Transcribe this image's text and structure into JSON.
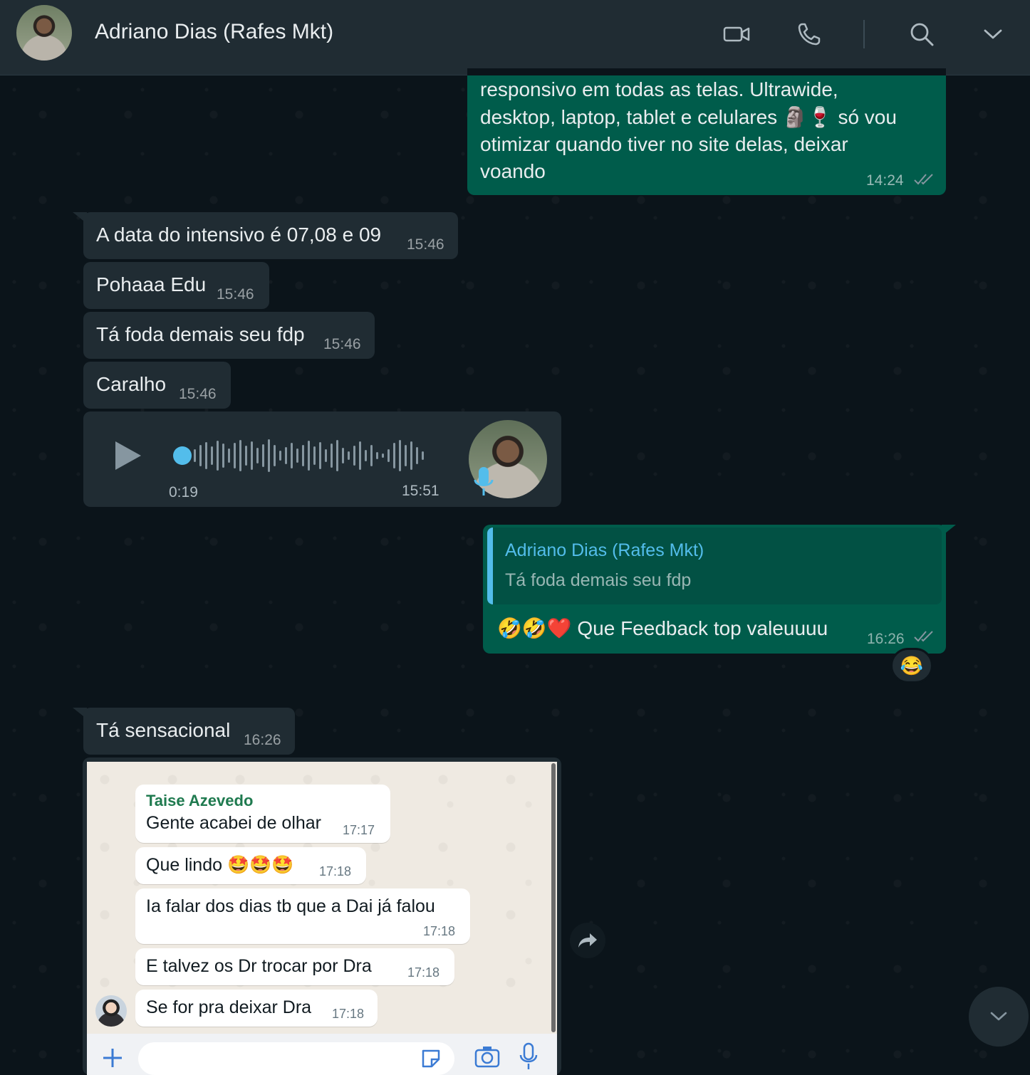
{
  "header": {
    "contact_name": "Adriano Dias (Rafes Mkt)",
    "icons": [
      "video-call-icon",
      "voice-call-icon",
      "search-icon",
      "chevron-down-icon"
    ]
  },
  "messages": {
    "m1": {
      "lines": [
        "responsivo em todas as telas. Ultrawide,",
        "desktop, laptop, tablet e celulares 🗿🍷 só vou",
        "otimizar quando tiver no site delas, deixar",
        "voando"
      ],
      "time": "14:24"
    },
    "m2": {
      "text": "A data do intensivo é 07,08 e 09",
      "time": "15:46"
    },
    "m3": {
      "text": "Pohaaa Edu",
      "time": "15:46"
    },
    "m4": {
      "text": "Tá foda demais seu fdp",
      "time": "15:46"
    },
    "m5": {
      "text": "Caralho",
      "time": "15:46"
    },
    "voice": {
      "duration": "0:19",
      "time": "15:51",
      "progress": 0
    },
    "reply": {
      "quoted_author": "Adriano Dias (Rafes Mkt)",
      "quoted_text": "Tá foda demais seu fdp",
      "text": "🤣🤣❤️ Que Feedback top valeuuuu",
      "time": "16:26",
      "reaction": "😂"
    },
    "m6": {
      "text": "Tá sensacional",
      "time": "16:26"
    }
  },
  "screenshot": {
    "sender": "Taise Azevedo",
    "items": [
      {
        "text": "Gente acabei de olhar",
        "time": "17:17"
      },
      {
        "text": "Que lindo 🤩🤩🤩",
        "time": "17:18"
      },
      {
        "text": "Ia falar dos dias tb que a Dai já falou",
        "time": "17:18"
      },
      {
        "text": "E talvez os Dr trocar por Dra",
        "time": "17:18"
      },
      {
        "text": "Se for pra deixar Dra",
        "time": "17:18"
      }
    ]
  },
  "colors": {
    "incoming": "#202c33",
    "outgoing": "#005c4b",
    "accent": "#53bdeb",
    "background": "#0b141a"
  }
}
